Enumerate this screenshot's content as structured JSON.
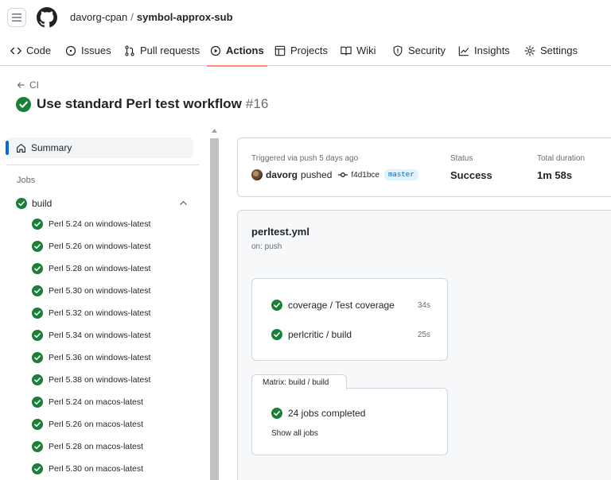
{
  "header": {
    "owner": "davorg-cpan",
    "separator": "/",
    "repo": "symbol-approx-sub"
  },
  "nav": {
    "tabs": [
      {
        "label": "Code",
        "icon": "code-icon"
      },
      {
        "label": "Issues",
        "icon": "issue-icon"
      },
      {
        "label": "Pull requests",
        "icon": "pull-request-icon"
      },
      {
        "label": "Actions",
        "icon": "play-icon",
        "active": true
      },
      {
        "label": "Projects",
        "icon": "table-icon"
      },
      {
        "label": "Wiki",
        "icon": "book-icon"
      },
      {
        "label": "Security",
        "icon": "shield-icon"
      },
      {
        "label": "Insights",
        "icon": "graph-icon"
      },
      {
        "label": "Settings",
        "icon": "gear-icon"
      }
    ]
  },
  "run": {
    "back_label": "CI",
    "title": "Use standard Perl test workflow",
    "number": "#16"
  },
  "sidebar": {
    "summary_label": "Summary",
    "jobs_heading": "Jobs",
    "group_label": "build",
    "jobs": [
      "Perl 5.24 on windows-latest",
      "Perl 5.26 on windows-latest",
      "Perl 5.28 on windows-latest",
      "Perl 5.30 on windows-latest",
      "Perl 5.32 on windows-latest",
      "Perl 5.34 on windows-latest",
      "Perl 5.36 on windows-latest",
      "Perl 5.38 on windows-latest",
      "Perl 5.24 on macos-latest",
      "Perl 5.26 on macos-latest",
      "Perl 5.28 on macos-latest",
      "Perl 5.30 on macos-latest"
    ]
  },
  "summary": {
    "trigger_label": "Triggered via push 5 days ago",
    "user": "davorg",
    "action": "pushed",
    "commit": "f4d1bce",
    "branch": "master",
    "status_label": "Status",
    "status_value": "Success",
    "duration_label": "Total duration",
    "duration_value": "1m 58s"
  },
  "workflow": {
    "file": "perltest.yml",
    "on": "on: push",
    "jobs": [
      {
        "label": "coverage / Test coverage",
        "duration": "34s"
      },
      {
        "label": "perlcritic / build",
        "duration": "25s"
      }
    ],
    "matrix": {
      "tab_label": "Matrix: build / build",
      "completed_label": "24 jobs completed",
      "show_all": "Show all jobs"
    }
  },
  "colors": {
    "success": "#1a7f37",
    "accent": "#0969da",
    "active_underline": "#fd8c73"
  }
}
